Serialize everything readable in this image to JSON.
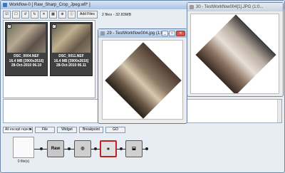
{
  "main_window": {
    "title": "Workflow-0 [ Raw_Sharp_Crop_Jpeg.wfl* ]",
    "toolbar": {
      "add_files_label": "Add Files",
      "file_count": "2 files - 32.83MB"
    },
    "thumbnails": [
      {
        "name": "DSC_0004.NEF",
        "info": "16.4 MB [3900x2616]",
        "date": "28-Oct-2010 06.10",
        "checked": "✓"
      },
      {
        "name": "DSC_0011.NEF",
        "info": "16.4 MB [3900x2616]",
        "date": "28-Oct-2010 06.11",
        "checked": "✓"
      }
    ],
    "bottom_bar": {
      "filter_select": "All except rejects",
      "file_label": "File",
      "widget_label": "Widget",
      "breakpoint_label": "Breakpoint",
      "go_label": "GO"
    },
    "pipeline": {
      "source_label": "0 file(s)",
      "nodes": [
        "Raw",
        "Sharpen",
        "Crop",
        "Save"
      ]
    }
  },
  "preview_window_1": {
    "title": "29 - TestWorkflow004.jpg (1:01 ..."
  },
  "preview_window_2": {
    "title": "30 - TestWorkflow004[1].JPG (1:0..."
  },
  "icons": {
    "close": "✕",
    "maximize": "□",
    "minimize": "_"
  }
}
